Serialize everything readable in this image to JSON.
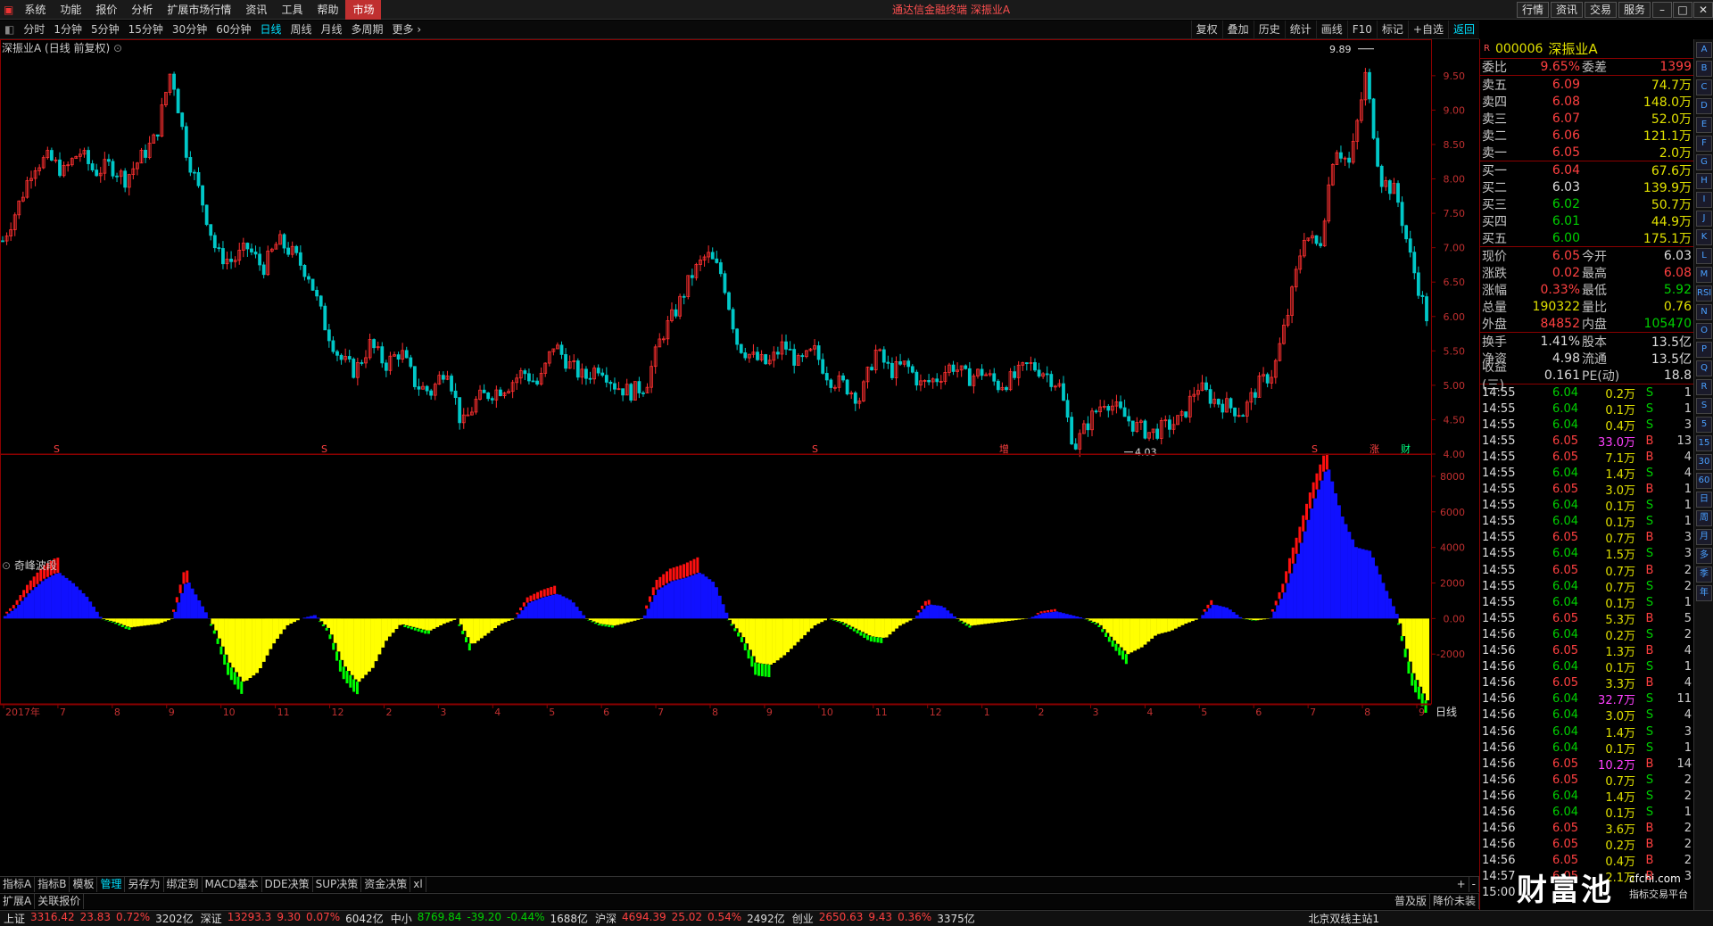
{
  "menu": {
    "items": [
      "系统",
      "功能",
      "报价",
      "分析",
      "扩展市场行情",
      "资讯",
      "工具",
      "帮助",
      "市场"
    ],
    "active": 8
  },
  "app_title": "通达信金融终端  深振业A",
  "top_buttons": [
    "行情",
    "资讯",
    "交易",
    "服务"
  ],
  "periods": [
    "分时",
    "1分钟",
    "5分钟",
    "15分钟",
    "30分钟",
    "60分钟",
    "日线",
    "周线",
    "月线",
    "多周期",
    "更多"
  ],
  "active_period": "日线",
  "chart_tools": [
    "复权",
    "叠加",
    "历史",
    "统计",
    "画线",
    "F10",
    "标记",
    "+自选",
    "返回"
  ],
  "chart_title": "深振业A (日线 前复权)",
  "indicator_title": "奇峰波段",
  "price_axis": [
    "9.50",
    "9.00",
    "8.50",
    "8.00",
    "7.50",
    "7.00",
    "6.50",
    "6.00",
    "5.50",
    "5.00",
    "4.50",
    "4.00"
  ],
  "ind_axis": [
    "8000",
    "6000",
    "4000",
    "2000",
    "0.00",
    "-2000"
  ],
  "high_label": "9.89",
  "low_label": "4.03",
  "event_marks": [
    {
      "t": "S",
      "k": "s1"
    },
    {
      "t": "S",
      "k": "s2"
    },
    {
      "t": "S",
      "k": "s3"
    },
    {
      "t": "增",
      "k": "zeng"
    },
    {
      "t": "S",
      "k": "s4"
    },
    {
      "t": "涨",
      "k": "zhang"
    },
    {
      "t": "财",
      "k": "cai"
    }
  ],
  "date_axis": [
    "2017年",
    "7",
    "8",
    "9",
    "10",
    "11",
    "12",
    "2",
    "3",
    "4",
    "5",
    "6",
    "7",
    "8",
    "9",
    "10",
    "11",
    "12",
    "1",
    "2",
    "3",
    "4",
    "5",
    "6",
    "7",
    "8",
    "9"
  ],
  "date_axis_right": "日线",
  "bottom_tabs": [
    "指标A",
    "指标B",
    "模板",
    "管理",
    "另存为",
    "绑定到",
    "MACD基本",
    "DDE决策",
    "SUP决策",
    "资金决策",
    "xl"
  ],
  "bottom_active": "管理",
  "bottom2": [
    "扩展A",
    "关联报价"
  ],
  "bottom2_right": [
    "普及版",
    "降价未装"
  ],
  "status": [
    {
      "name": "上证",
      "price": "3316.42",
      "chg": "23.83",
      "pct": "0.72%",
      "amt": "3202亿"
    },
    {
      "name": "深证",
      "price": "13293.3",
      "chg": "9.30",
      "pct": "0.07%",
      "amt": "6042亿"
    },
    {
      "name": "中小",
      "price": "8769.84",
      "chg": "-39.20",
      "pct": "-0.44%",
      "amt": "1688亿"
    },
    {
      "name": "沪深",
      "price": "4694.39",
      "chg": "25.02",
      "pct": "0.54%",
      "amt": "2492亿"
    },
    {
      "name": "创业",
      "price": "2650.63",
      "chg": "9.43",
      "pct": "0.36%",
      "amt": "3375亿"
    }
  ],
  "status_right": "北京双线主站1",
  "quote": {
    "code": "000006",
    "name": "深振业A",
    "webi": {
      "label": "委比",
      "val": "9.65%",
      "label2": "委差",
      "val2": "1399"
    },
    "asks": [
      {
        "l": "卖五",
        "p": "6.09",
        "v": "74.7万"
      },
      {
        "l": "卖四",
        "p": "6.08",
        "v": "148.0万"
      },
      {
        "l": "卖三",
        "p": "6.07",
        "v": "52.0万"
      },
      {
        "l": "卖二",
        "p": "6.06",
        "v": "121.1万"
      },
      {
        "l": "卖一",
        "p": "6.05",
        "v": "2.0万"
      }
    ],
    "bids": [
      {
        "l": "买一",
        "p": "6.04",
        "v": "67.6万"
      },
      {
        "l": "买二",
        "p": "6.03",
        "v": "139.9万"
      },
      {
        "l": "买三",
        "p": "6.02",
        "v": "50.7万"
      },
      {
        "l": "买四",
        "p": "6.01",
        "v": "44.9万"
      },
      {
        "l": "买五",
        "p": "6.00",
        "v": "175.1万"
      }
    ],
    "stats": [
      {
        "l": "现价",
        "v": "6.05",
        "c": "up",
        "l2": "今开",
        "v2": "6.03",
        "c2": "wh"
      },
      {
        "l": "涨跌",
        "v": "0.02",
        "c": "up",
        "l2": "最高",
        "v2": "6.08",
        "c2": "up"
      },
      {
        "l": "涨幅",
        "v": "0.33%",
        "c": "up",
        "l2": "最低",
        "v2": "5.92",
        "c2": "dn"
      },
      {
        "l": "总量",
        "v": "190322",
        "c": "yl",
        "l2": "量比",
        "v2": "0.76",
        "c2": "yl"
      },
      {
        "l": "外盘",
        "v": "84852",
        "c": "up",
        "l2": "内盘",
        "v2": "105470",
        "c2": "dn"
      }
    ],
    "stats2": [
      {
        "l": "换手",
        "v": "1.41%",
        "l2": "股本",
        "v2": "13.5亿"
      },
      {
        "l": "净资",
        "v": "4.98",
        "l2": "流通",
        "v2": "13.5亿"
      },
      {
        "l": "收益(三)",
        "v": "0.161",
        "l2": "PE(动)",
        "v2": "18.8"
      }
    ],
    "trades": [
      [
        "14:55",
        "6.04",
        "0.2万",
        "S",
        "1"
      ],
      [
        "14:55",
        "6.04",
        "0.1万",
        "S",
        "1"
      ],
      [
        "14:55",
        "6.04",
        "0.4万",
        "S",
        "3"
      ],
      [
        "14:55",
        "6.05",
        "33.0万",
        "B",
        "13"
      ],
      [
        "14:55",
        "6.05",
        "7.1万",
        "B",
        "4"
      ],
      [
        "14:55",
        "6.04",
        "1.4万",
        "S",
        "4"
      ],
      [
        "14:55",
        "6.05",
        "3.0万",
        "B",
        "1"
      ],
      [
        "14:55",
        "6.04",
        "0.1万",
        "S",
        "1"
      ],
      [
        "14:55",
        "6.04",
        "0.1万",
        "S",
        "1"
      ],
      [
        "14:55",
        "6.05",
        "0.7万",
        "B",
        "3"
      ],
      [
        "14:55",
        "6.04",
        "1.5万",
        "S",
        "3"
      ],
      [
        "14:55",
        "6.05",
        "0.7万",
        "B",
        "2"
      ],
      [
        "14:55",
        "6.04",
        "0.7万",
        "S",
        "2"
      ],
      [
        "14:55",
        "6.04",
        "0.1万",
        "S",
        "1"
      ],
      [
        "14:55",
        "6.05",
        "5.3万",
        "B",
        "5"
      ],
      [
        "14:56",
        "6.04",
        "0.2万",
        "S",
        "2"
      ],
      [
        "14:56",
        "6.05",
        "1.3万",
        "B",
        "4"
      ],
      [
        "14:56",
        "6.04",
        "0.1万",
        "S",
        "1"
      ],
      [
        "14:56",
        "6.05",
        "3.3万",
        "B",
        "4"
      ],
      [
        "14:56",
        "6.04",
        "32.7万",
        "S",
        "11"
      ],
      [
        "14:56",
        "6.04",
        "3.0万",
        "S",
        "4"
      ],
      [
        "14:56",
        "6.04",
        "1.4万",
        "S",
        "3"
      ],
      [
        "14:56",
        "6.04",
        "0.1万",
        "S",
        "1"
      ],
      [
        "14:56",
        "6.05",
        "10.2万",
        "B",
        "14"
      ],
      [
        "14:56",
        "6.05",
        "0.7万",
        "S",
        "2"
      ],
      [
        "14:56",
        "6.04",
        "1.4万",
        "S",
        "2"
      ],
      [
        "14:56",
        "6.04",
        "0.1万",
        "S",
        "1"
      ],
      [
        "14:56",
        "6.05",
        "3.6万",
        "B",
        "2"
      ],
      [
        "14:56",
        "6.05",
        "0.2万",
        "B",
        "2"
      ],
      [
        "14:56",
        "6.05",
        "0.4万",
        "B",
        "2"
      ],
      [
        "14:57",
        "6.05",
        "2.1万",
        "B",
        "3"
      ],
      [
        "15:00",
        "",
        "",
        "",
        ""
      ]
    ]
  },
  "logo": {
    "main": "财富池",
    "site": "cfchi.com",
    "sub": "指标交易平台"
  },
  "side_icons": [
    "A",
    "B",
    "C",
    "D",
    "E",
    "F",
    "G",
    "H",
    "I",
    "J",
    "K",
    "L",
    "M",
    "RSI",
    "N",
    "O",
    "P",
    "Q",
    "R",
    "S",
    "5",
    "15",
    "30",
    "60",
    "日",
    "周",
    "月",
    "多",
    "季",
    "年"
  ],
  "colors": {
    "up": "#ff3030",
    "down": "#00c8c8",
    "bar_red": "#ff1010",
    "bar_blue": "#1010ff",
    "bar_yellow": "#ffff00",
    "bar_green": "#00ff00",
    "axis": "#8b0000"
  },
  "chart_data": [
    {
      "type": "candlestick",
      "title": "深振业A (日线 前复权)",
      "ylim": [
        4.0,
        9.9
      ],
      "yticks": [
        4.0,
        4.5,
        5.0,
        5.5,
        6.0,
        6.5,
        7.0,
        7.5,
        8.0,
        8.5,
        9.0,
        9.5
      ],
      "annotations": [
        {
          "label": "9.89",
          "value": 9.89
        },
        {
          "label": "4.03",
          "value": 4.03
        }
      ],
      "x_labels": [
        "2017年",
        "7",
        "8",
        "9",
        "10",
        "11",
        "12",
        "2",
        "3",
        "4",
        "5",
        "6",
        "7",
        "8",
        "9",
        "10",
        "11",
        "12",
        "1",
        "2",
        "3",
        "4",
        "5",
        "6",
        "7",
        "8",
        "9"
      ],
      "close_path": [
        7.1,
        7.6,
        8.2,
        8.3,
        8.1,
        8.4,
        8.1,
        8.2,
        8.0,
        8.3,
        8.6,
        9.6,
        8.4,
        7.7,
        6.9,
        6.8,
        7.0,
        6.7,
        7.1,
        6.9,
        6.6,
        5.9,
        5.4,
        5.2,
        5.6,
        5.3,
        5.5,
        5.0,
        4.9,
        5.3,
        4.4,
        4.8,
        4.9,
        5.0,
        5.2,
        5.0,
        5.6,
        5.3,
        5.1,
        5.3,
        5.0,
        4.9,
        5.0,
        5.7,
        6.1,
        6.6,
        6.9,
        6.6,
        5.6,
        5.4,
        5.3,
        5.6,
        5.3,
        5.5,
        5.1,
        5.0,
        4.8,
        5.5,
        5.2,
        5.3,
        5.0,
        5.1,
        5.3,
        5.1,
        5.2,
        5.0,
        5.1,
        5.3,
        5.2,
        5.0,
        4.1,
        4.5,
        4.8,
        4.6,
        4.4,
        4.3,
        4.4,
        4.5,
        5.0,
        4.8,
        4.7,
        4.6,
        5.0,
        5.2,
        6.1,
        7.2,
        7.0,
        8.5,
        8.2,
        9.5,
        8.0,
        7.8,
        6.8,
        6.0
      ]
    },
    {
      "type": "area",
      "title": "奇峰波段",
      "ylim": [
        -4800,
        9000
      ],
      "yticks": [
        -2000,
        0,
        2000,
        4000,
        6000,
        8000
      ],
      "values": [
        0,
        600,
        1500,
        2200,
        2600,
        2000,
        1200,
        0,
        -200,
        -500,
        -400,
        -300,
        0,
        2200,
        800,
        -600,
        -2500,
        -3600,
        -3000,
        -1500,
        -400,
        0,
        200,
        -600,
        -2600,
        -3600,
        -2800,
        -1200,
        -300,
        -500,
        -700,
        -300,
        0,
        -1500,
        -900,
        -300,
        0,
        900,
        1200,
        1400,
        1000,
        0,
        -300,
        -400,
        -200,
        0,
        1600,
        2100,
        2300,
        2600,
        2000,
        0,
        -1000,
        -2500,
        -2600,
        -2000,
        -1200,
        -400,
        0,
        -200,
        -600,
        -1000,
        -1100,
        -400,
        0,
        800,
        700,
        0,
        -400,
        -300,
        -200,
        -100,
        0,
        300,
        400,
        200,
        0,
        -300,
        -1200,
        -2000,
        -1600,
        -900,
        -700,
        -300,
        0,
        800,
        600,
        0,
        -100,
        0,
        1500,
        3800,
        6500,
        8600,
        5800,
        4000,
        3800,
        1800,
        0,
        -3000,
        -4600
      ]
    }
  ]
}
